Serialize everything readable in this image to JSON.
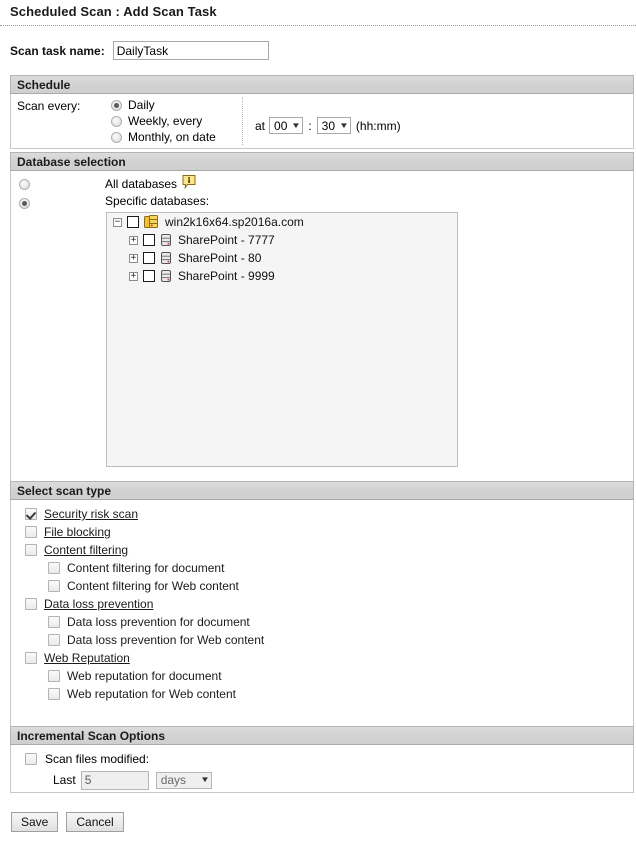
{
  "header": {
    "title": "Scheduled Scan : Add Scan Task"
  },
  "task_name": {
    "label": "Scan task name:",
    "value": "DailyTask",
    "placeholder": ""
  },
  "schedule": {
    "section_title": "Schedule",
    "scan_every_label": "Scan every:",
    "options": [
      {
        "label": "Daily",
        "selected": true
      },
      {
        "label": "Weekly, every",
        "selected": false
      },
      {
        "label": "Monthly, on date",
        "selected": false
      }
    ],
    "at_label": "at",
    "hour": "00",
    "separator": ":",
    "minute": "30",
    "format_hint": "(hh:mm)"
  },
  "database_selection": {
    "section_title": "Database selection",
    "all_databases_label": "All databases",
    "all_databases_selected": false,
    "info_icon": "info-balloon-icon",
    "specific_databases_label": "Specific databases:",
    "specific_databases_selected": true,
    "tree": {
      "root": {
        "label": "win2k16x64.sp2016a.com",
        "expander": "−",
        "checked": false,
        "icon": "server-group-icon"
      },
      "children": [
        {
          "label": "SharePoint - 7777",
          "expander": "+",
          "checked": false,
          "icon": "database-icon"
        },
        {
          "label": "SharePoint - 80",
          "expander": "+",
          "checked": false,
          "icon": "database-icon"
        },
        {
          "label": "SharePoint - 9999",
          "expander": "+",
          "checked": false,
          "icon": "database-icon"
        }
      ]
    }
  },
  "scan_type": {
    "section_title": "Select scan type",
    "items": [
      {
        "label": "Security risk scan",
        "checked": true,
        "link": true,
        "sub": false
      },
      {
        "label": "File blocking",
        "checked": false,
        "link": true,
        "sub": false
      },
      {
        "label": "Content filtering",
        "checked": false,
        "link": true,
        "sub": false
      },
      {
        "label": "Content filtering for document",
        "checked": false,
        "link": false,
        "sub": true
      },
      {
        "label": "Content filtering for Web content",
        "checked": false,
        "link": false,
        "sub": true
      },
      {
        "label": "Data loss prevention",
        "checked": false,
        "link": true,
        "sub": false
      },
      {
        "label": "Data loss prevention for document",
        "checked": false,
        "link": false,
        "sub": true
      },
      {
        "label": "Data loss prevention for Web content",
        "checked": false,
        "link": false,
        "sub": true
      },
      {
        "label": "Web Reputation",
        "checked": false,
        "link": true,
        "sub": false
      },
      {
        "label": "Web reputation for document",
        "checked": false,
        "link": false,
        "sub": true
      },
      {
        "label": "Web reputation for Web content",
        "checked": false,
        "link": false,
        "sub": true
      }
    ]
  },
  "incremental": {
    "section_title": "Incremental Scan Options",
    "scan_files_modified_label": "Scan files modified:",
    "scan_files_modified_checked": false,
    "last_label": "Last",
    "last_value": "5",
    "unit_value": "days"
  },
  "buttons": {
    "save": "Save",
    "cancel": "Cancel"
  },
  "colors": {
    "panel_header_bg": "#d3d3d3",
    "panel_border": "#c8c8c8",
    "tree_bg": "#f5f5f5",
    "link_text": "#1b1b1b",
    "page_bg": "#ffffff"
  }
}
